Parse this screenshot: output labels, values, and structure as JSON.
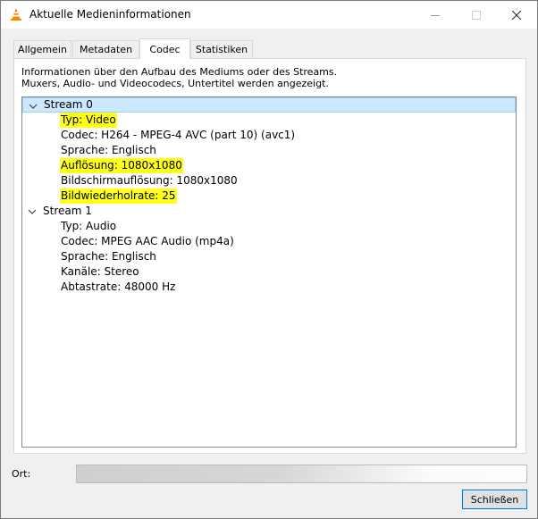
{
  "window": {
    "title": "Aktuelle Medieninformationen",
    "icon": "vlc-cone-icon"
  },
  "tabs": [
    {
      "label": "Allgemein",
      "active": false
    },
    {
      "label": "Metadaten",
      "active": false
    },
    {
      "label": "Codec",
      "active": true
    },
    {
      "label": "Statistiken",
      "active": false
    }
  ],
  "codec": {
    "description_line1": "Informationen über den Aufbau des Mediums oder des Streams.",
    "description_line2": "Muxers, Audio- und Videocodecs, Untertitel werden angezeigt.",
    "streams": [
      {
        "label": "Stream 0",
        "expanded": true,
        "selected": true,
        "items": [
          {
            "text": "Typ: Video",
            "highlighted": true
          },
          {
            "text": "Codec: H264 - MPEG-4 AVC (part 10) (avc1)",
            "highlighted": false
          },
          {
            "text": "Sprache: Englisch",
            "highlighted": false
          },
          {
            "text": "Auflösung: 1080x1080",
            "highlighted": true
          },
          {
            "text": "Bildschirmauflösung: 1080x1080",
            "highlighted": false
          },
          {
            "text": "Bildwiederholrate: 25",
            "highlighted": true
          }
        ]
      },
      {
        "label": "Stream 1",
        "expanded": true,
        "selected": false,
        "items": [
          {
            "text": "Typ: Audio",
            "highlighted": false
          },
          {
            "text": "Codec: MPEG AAC Audio (mp4a)",
            "highlighted": false
          },
          {
            "text": "Sprache: Englisch",
            "highlighted": false
          },
          {
            "text": "Kanäle: Stereo",
            "highlighted": false
          },
          {
            "text": "Abtastrate: 48000 Hz",
            "highlighted": false
          }
        ]
      }
    ]
  },
  "footer": {
    "location_label": "Ort:",
    "location_value": "",
    "close_label": "Schließen"
  },
  "colors": {
    "highlight": "#ffff1a",
    "selection": "#cce8ff",
    "vlc_orange": "#ff8800"
  }
}
